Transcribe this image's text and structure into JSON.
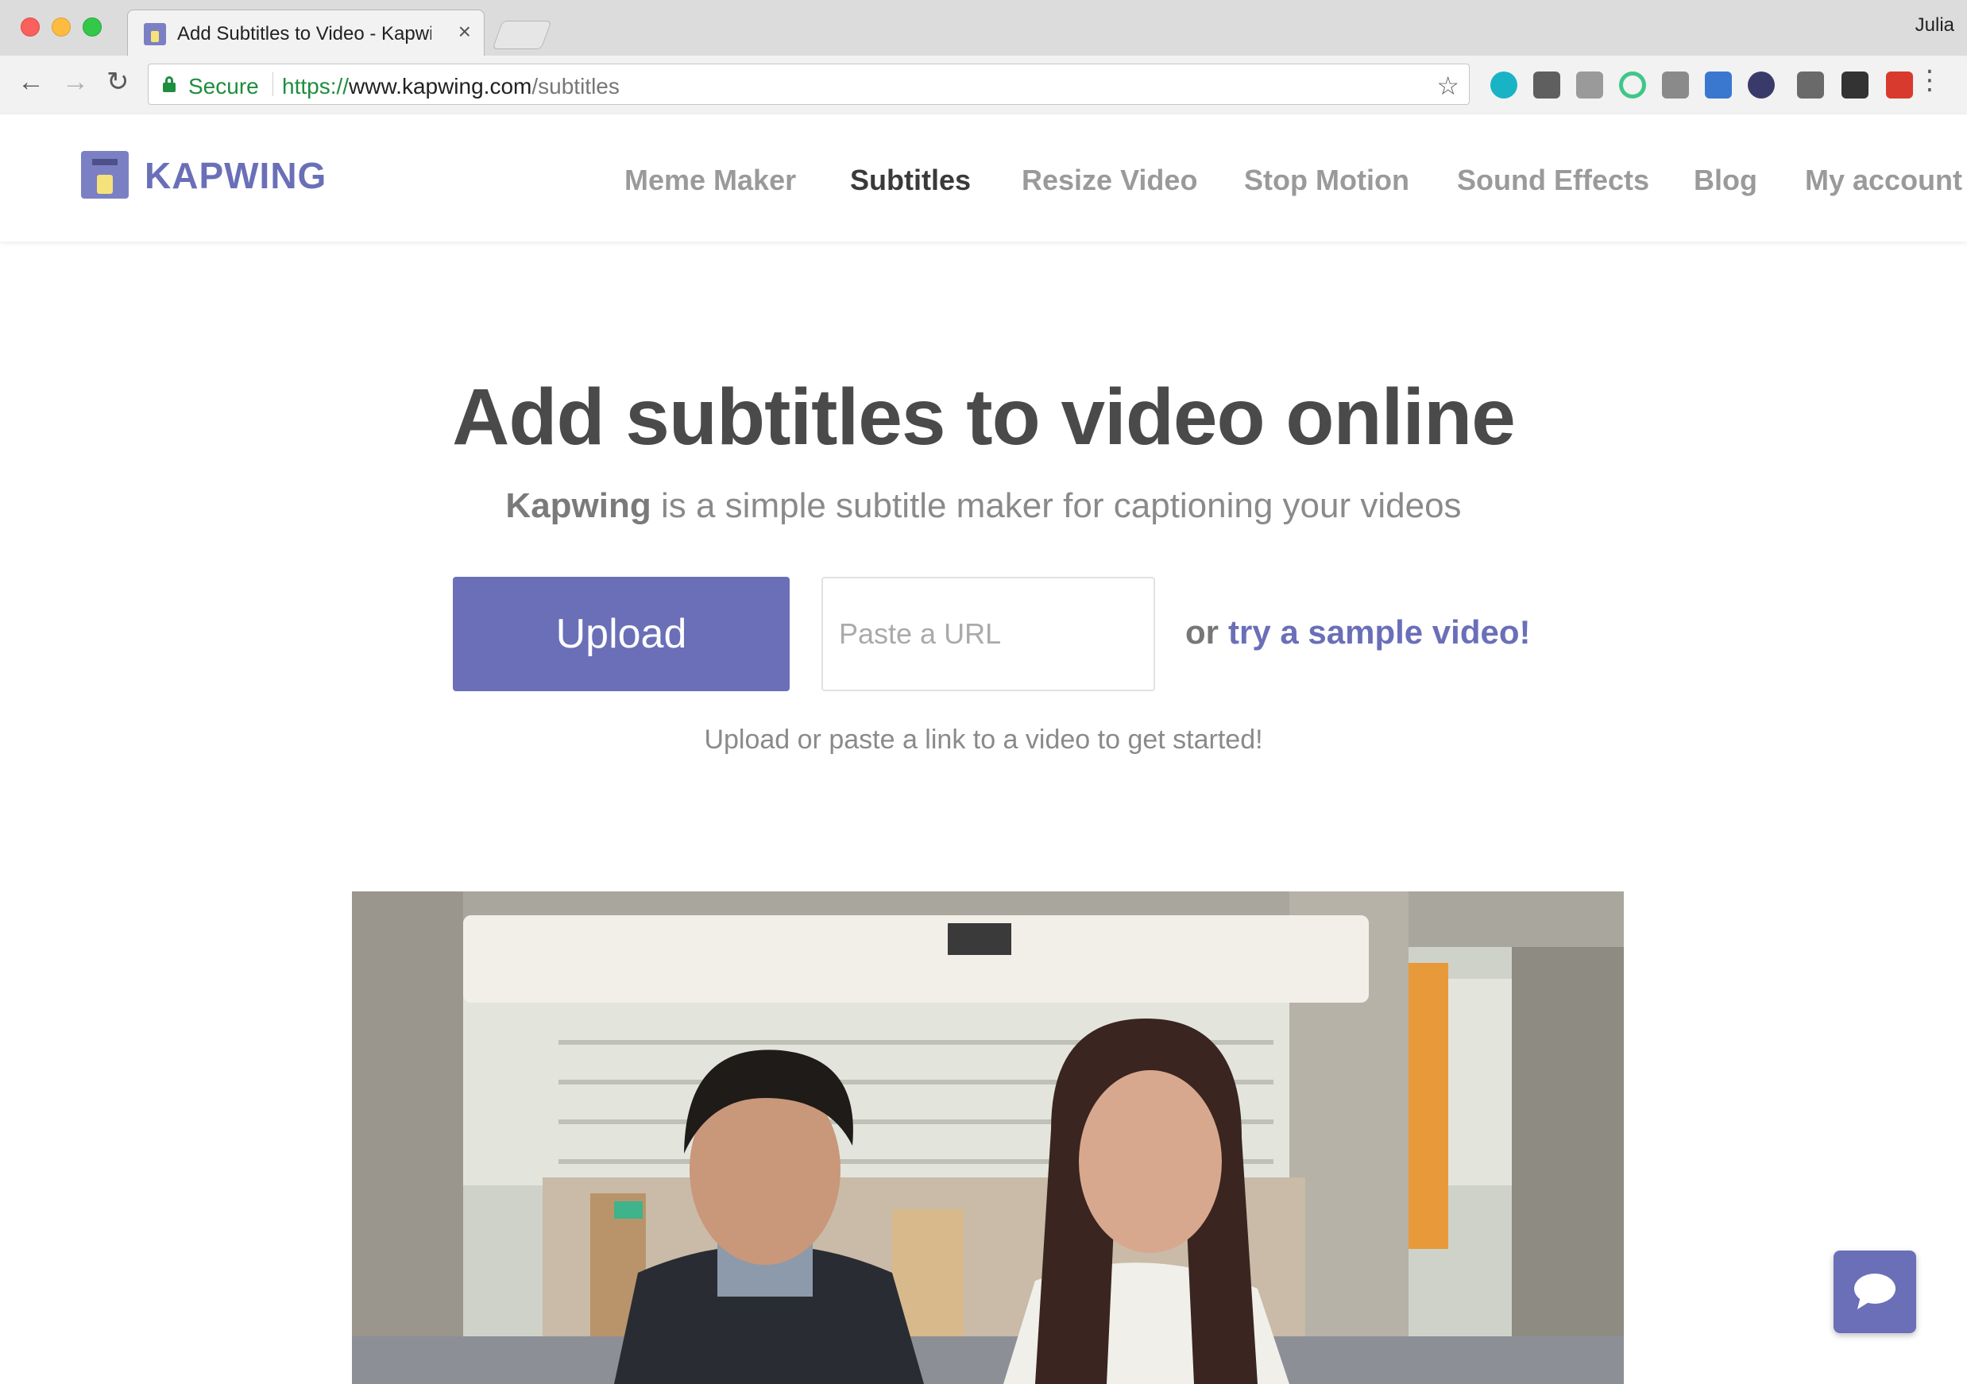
{
  "browser": {
    "tab_title": "Add Subtitles to Video - Kapwing",
    "tab_close": "×",
    "profile_name": "Julia",
    "secure_label": "Secure",
    "url_scheme": "https://",
    "url_host": "www.kapwing.com",
    "url_path": "/subtitles",
    "icons": [
      "back-arrow-icon",
      "forward-arrow-icon",
      "reload-icon",
      "lock-icon",
      "star-icon",
      "menu-dots-icon"
    ],
    "extensions": [
      {
        "name": "extension-m-icon",
        "color": "#19b3c6"
      },
      {
        "name": "extension-lightbulb-icon",
        "color": "#5f5f5f"
      },
      {
        "name": "extension-camera-icon",
        "color": "#9a9a9a"
      },
      {
        "name": "extension-circle-icon",
        "color": "#3ec78a"
      },
      {
        "name": "extension-puzzle-icon",
        "color": "#8a8a8a"
      },
      {
        "name": "extension-arrows-icon",
        "color": "#3a78d0"
      },
      {
        "name": "extension-moon-icon",
        "color": "#3a3a6a"
      },
      {
        "name": "extension-info-icon",
        "color": "#6a6a6a"
      },
      {
        "name": "extension-film-icon",
        "color": "#333333"
      },
      {
        "name": "extension-red-dots-icon",
        "color": "#d93a2e"
      }
    ]
  },
  "site": {
    "logo_text": "KAPWING",
    "brand_color": "#6a6fb8",
    "nav": [
      {
        "label": "Meme Maker",
        "active": false
      },
      {
        "label": "Subtitles",
        "active": true
      },
      {
        "label": "Resize Video",
        "active": false
      },
      {
        "label": "Stop Motion",
        "active": false
      },
      {
        "label": "Sound Effects",
        "active": false
      },
      {
        "label": "Blog",
        "active": false
      },
      {
        "label": "My account",
        "active": false
      }
    ]
  },
  "hero": {
    "title": "Add subtitles to video online",
    "subtitle_brand": "Kapwing",
    "subtitle_rest": " is a simple subtitle maker for captioning your videos",
    "upload_label": "Upload",
    "url_placeholder": "Paste a URL",
    "or_text": "or",
    "sample_link": "try a sample video!",
    "hint": "Upload or paste a link to a video to get started!"
  },
  "video": {
    "description_icon": "video-preview"
  },
  "chat": {
    "icon": "chat-bubble-icon"
  }
}
